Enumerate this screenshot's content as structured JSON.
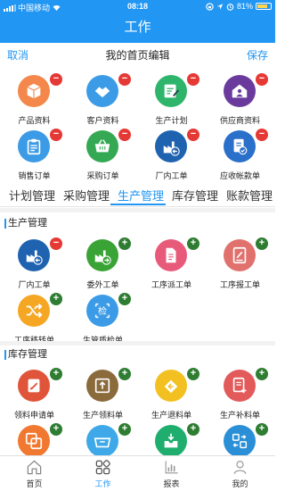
{
  "status_bar": {
    "carrier": "中国移动",
    "time": "08:18",
    "battery": "81%"
  },
  "header": {
    "title": "工作"
  },
  "edit_bar": {
    "cancel": "取消",
    "title": "我的首页编辑",
    "save": "保存"
  },
  "home_items": [
    {
      "label": "产品资料",
      "icon": "box-icon",
      "color": "#f4874b",
      "badge": "-"
    },
    {
      "label": "客户资料",
      "icon": "handshake-icon",
      "color": "#3c9be6",
      "badge": "-"
    },
    {
      "label": "生产计划",
      "icon": "plan-board-icon",
      "color": "#2fb56b",
      "badge": "-"
    },
    {
      "label": "供应商资料",
      "icon": "supplier-house-icon",
      "color": "#6a3a9c",
      "badge": "-"
    },
    {
      "label": "销售订单",
      "icon": "clipboard-icon",
      "color": "#3c9be6",
      "badge": "-"
    },
    {
      "label": "采购订单",
      "icon": "basket-icon",
      "color": "#34a853",
      "badge": "-"
    },
    {
      "label": "厂内工单",
      "icon": "factory-icon",
      "color": "#1f63b0",
      "badge": "-"
    },
    {
      "label": "应收帐款单",
      "icon": "receivable-icon",
      "color": "#2a6fc9",
      "badge": "-"
    }
  ],
  "category_tabs": [
    "计划管理",
    "采购管理",
    "生产管理",
    "库存管理",
    "账款管理"
  ],
  "active_tab_index": 2,
  "sections": [
    {
      "title": "生产管理",
      "items": [
        {
          "label": "厂内工单",
          "icon": "factory-icon",
          "color": "#1f63b0",
          "badge": "-"
        },
        {
          "label": "委外工单",
          "icon": "outsource-factory-icon",
          "color": "#3aa335",
          "badge": "+"
        },
        {
          "label": "工序派工单",
          "icon": "dispatch-doc-icon",
          "color": "#e85a7a",
          "badge": "+"
        },
        {
          "label": "工序报工单",
          "icon": "report-doc-icon",
          "color": "#e0716c",
          "badge": "+"
        },
        {
          "label": "工序移转单",
          "icon": "shuffle-icon",
          "color": "#f5a623",
          "badge": "+"
        },
        {
          "label": "生管质检单",
          "icon": "inspect-icon",
          "color": "#3c9be6",
          "badge": "+"
        }
      ]
    },
    {
      "title": "库存管理",
      "items": [
        {
          "label": "领料申请单",
          "icon": "edit-doc-icon",
          "color": "#e0553a",
          "badge": "+"
        },
        {
          "label": "生产领料单",
          "icon": "pick-box-icon",
          "color": "#8b6a3c",
          "badge": "+"
        },
        {
          "label": "生产退料单",
          "icon": "return-icon",
          "color": "#f2c020",
          "badge": "+"
        },
        {
          "label": "生产补料单",
          "icon": "supplement-doc-icon",
          "color": "#e25a5a",
          "badge": "+"
        },
        {
          "label": "",
          "icon": "layers-icon",
          "color": "#f07830",
          "badge": "+"
        },
        {
          "label": "",
          "icon": "cart-basket-icon",
          "color": "#3ea8e8",
          "badge": "+"
        },
        {
          "label": "",
          "icon": "inbox-icon",
          "color": "#1fae6e",
          "badge": "+"
        },
        {
          "label": "",
          "icon": "transfer-grid-icon",
          "color": "#2a8fd6",
          "badge": "+"
        }
      ]
    }
  ],
  "bottom_nav": [
    {
      "label": "首页",
      "icon": "home-icon"
    },
    {
      "label": "工作",
      "icon": "grid-icon"
    },
    {
      "label": "报表",
      "icon": "chart-icon"
    },
    {
      "label": "我的",
      "icon": "person-icon"
    }
  ],
  "active_nav_index": 1
}
